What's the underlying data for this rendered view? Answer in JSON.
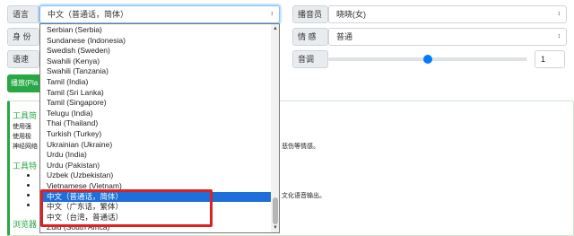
{
  "form": {
    "language_label": "语言",
    "language_value": "中文（普通话，简体）",
    "identity_label": "身 份",
    "speed_label": "语速",
    "voice_label": "播音员",
    "voice_value": "晓晓(女)",
    "emotion_label": "情 感",
    "emotion_value": "普通",
    "pitch_label": "音调",
    "pitch_value": "1",
    "pitch_level": 0.5
  },
  "play_button": "播放(Pla",
  "panel": {
    "heading1": "工具简",
    "line1": "使用强",
    "line2": "使用极",
    "line3": "神经网络",
    "tail_text1": "悲伤等情感。",
    "heading2": "工具特",
    "tail_text2": "文化语音输出。",
    "heading3": "浏览器"
  },
  "dropdown": {
    "options": [
      "Serbian (Serbia)",
      "Sundanese (Indonesia)",
      "Swedish (Sweden)",
      "Swahili (Kenya)",
      "Swahili (Tanzania)",
      "Tamil (India)",
      "Tamil (Sri Lanka)",
      "Tamil (Singapore)",
      "Telugu (India)",
      "Thai (Thailand)",
      "Turkish (Turkey)",
      "Ukrainian (Ukraine)",
      "Urdu (India)",
      "Urdu (Pakistan)",
      "Uzbek (Uzbekistan)",
      "Vietnamese (Vietnam)",
      "中文（普通话，简体）",
      "中文（广东话，繁体）",
      "中文（台湾，普通话）",
      "Zulu (South Africa)"
    ],
    "selected_index": 16
  },
  "icons": {
    "select_caret": "updown-caret-icon",
    "scroll_up": "scroll-up-arrow-icon",
    "scroll_down": "scroll-down-arrow-icon"
  },
  "colors": {
    "accent_green": "#28a745",
    "slider_blue": "#007bff",
    "selection_blue": "#1e6fd9",
    "annotation_red": "#e02020"
  }
}
